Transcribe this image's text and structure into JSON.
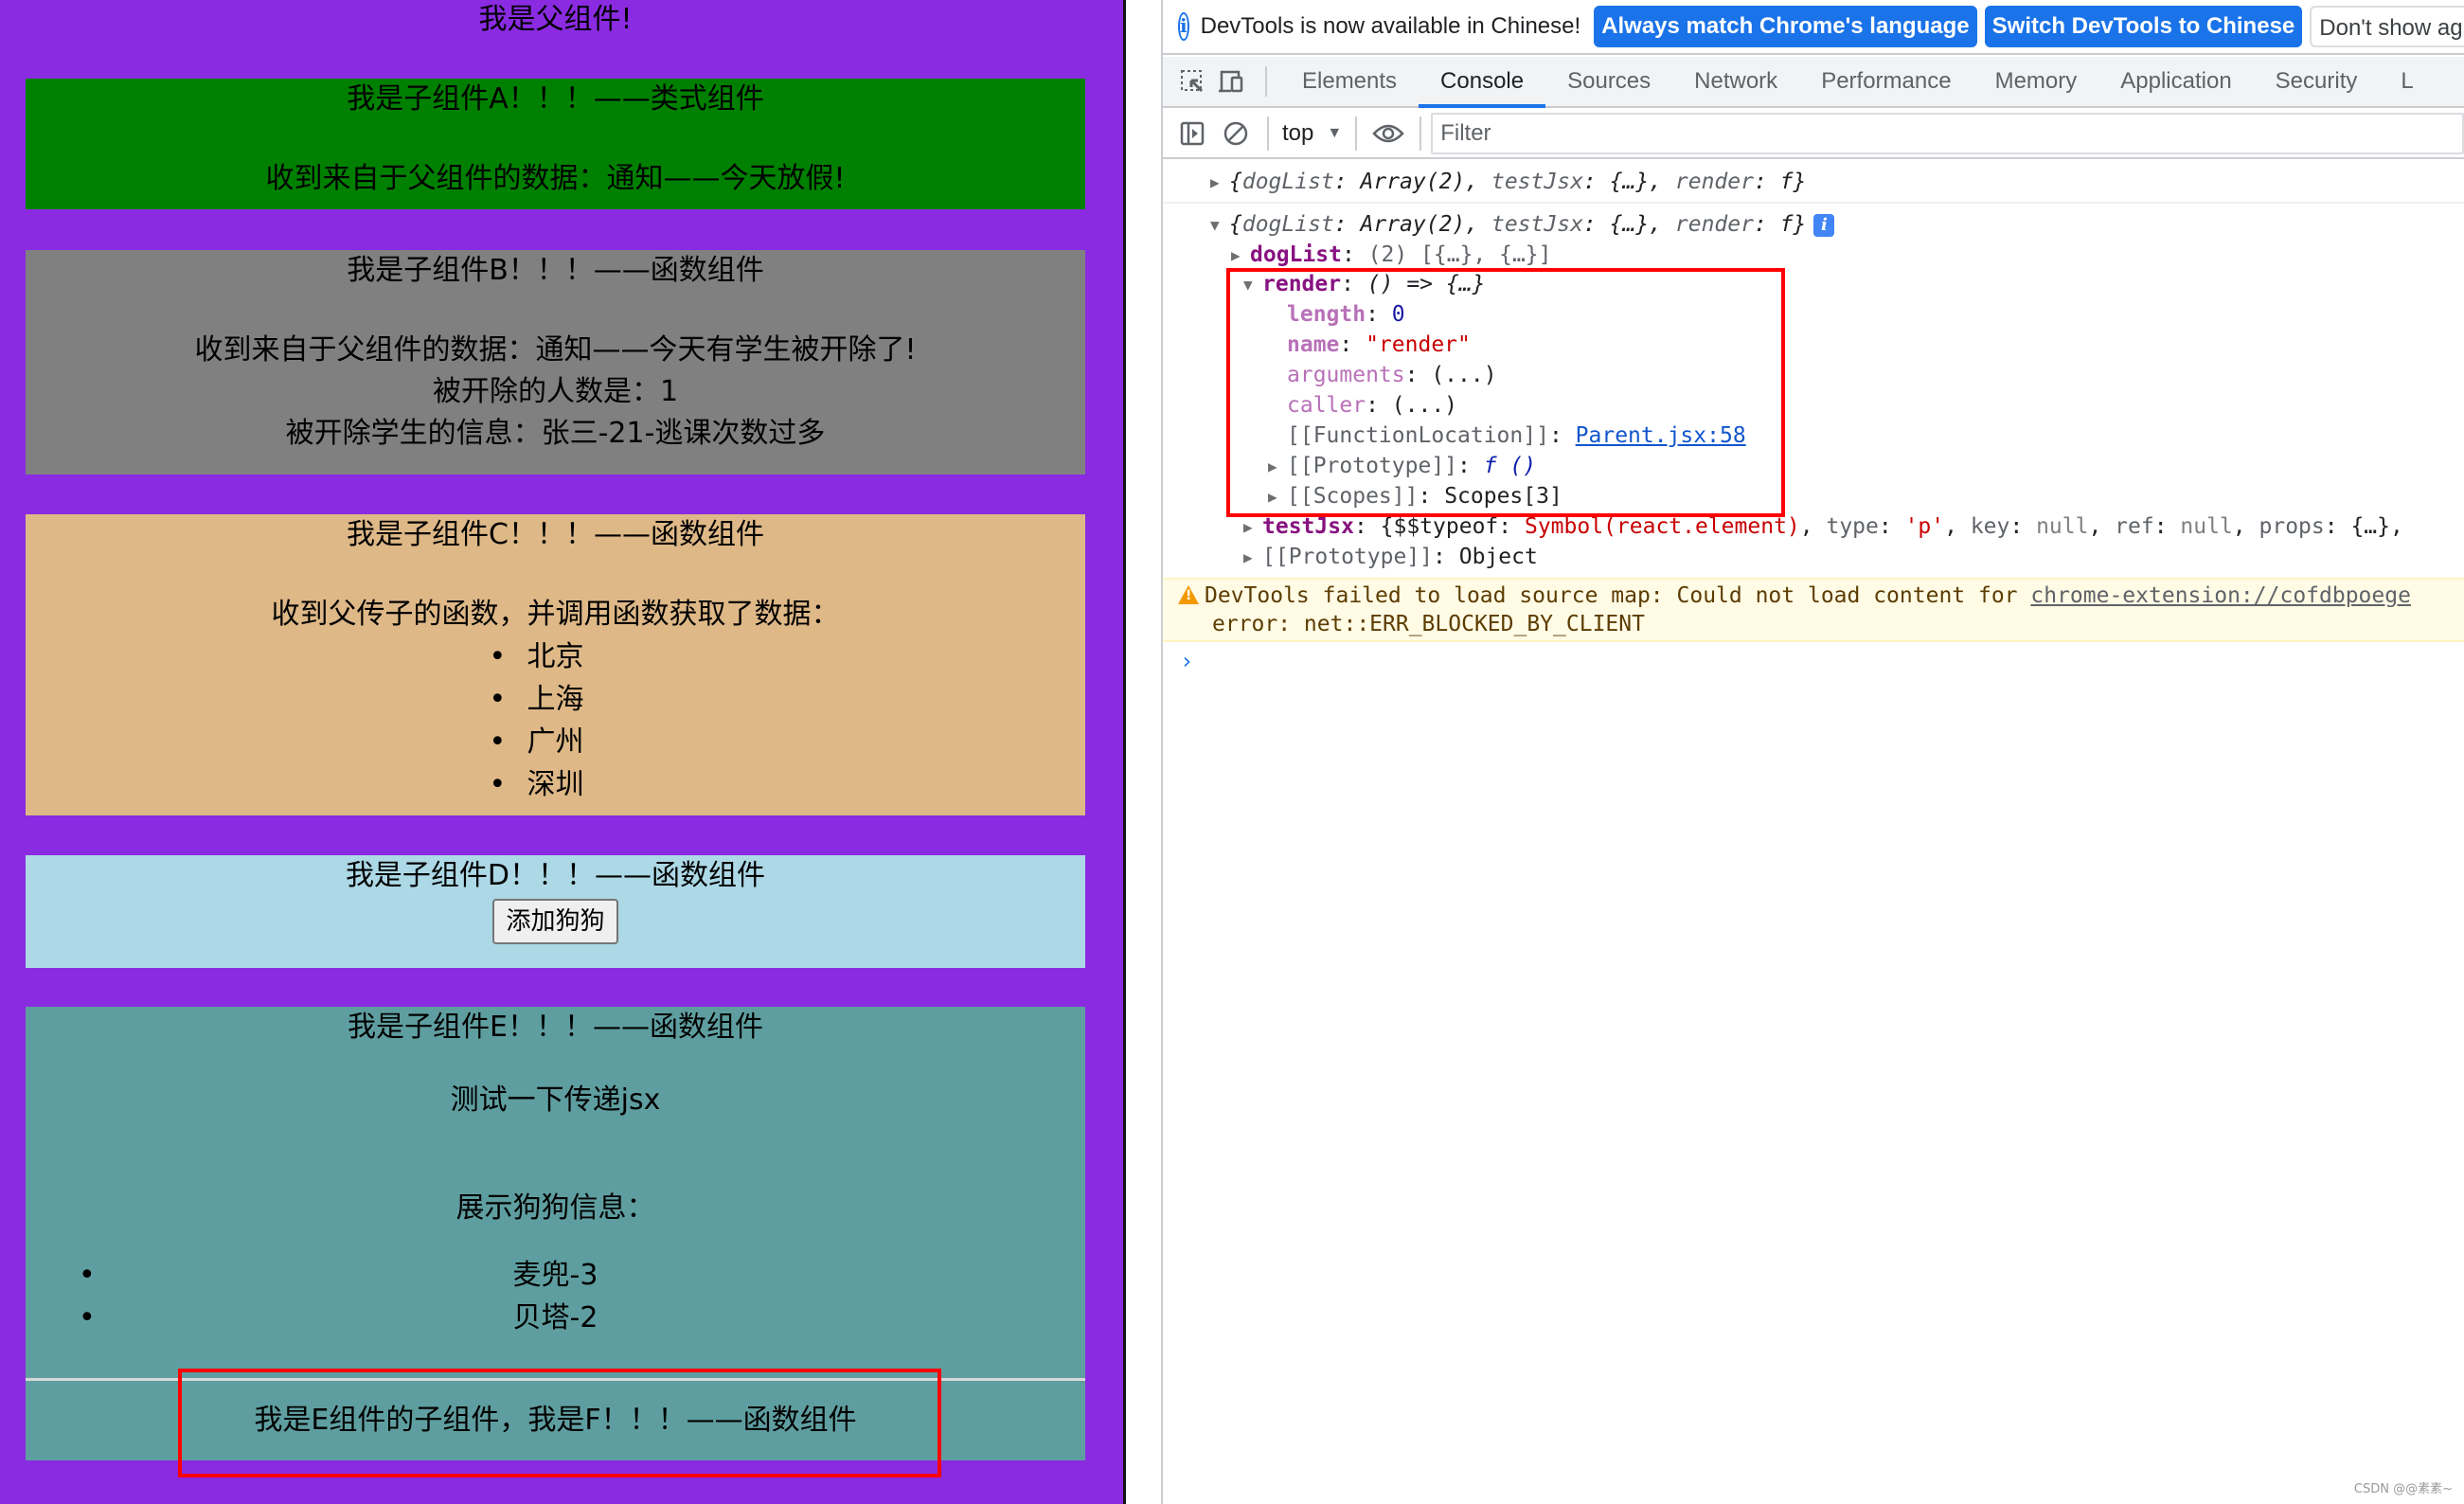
{
  "app": {
    "parent_title": "我是父组件!",
    "background_color": "#8a2be2",
    "child_a": {
      "title": "我是子组件A！！！——类式组件",
      "message": "收到来自于父组件的数据：通知——今天放假!",
      "color": "#008000"
    },
    "child_b": {
      "title": "我是子组件B！！！——函数组件",
      "message": "收到来自于父组件的数据：通知——今天有学生被开除了!",
      "count_line": "被开除的人数是：1",
      "info_line": "被开除学生的信息：张三-21-逃课次数过多",
      "color": "#808080"
    },
    "child_c": {
      "title": "我是子组件C！！！——函数组件",
      "message": "收到父传子的函数，并调用函数获取了数据：",
      "cities": [
        "北京",
        "上海",
        "广州",
        "深圳"
      ],
      "color": "#deb887"
    },
    "child_d": {
      "title": "我是子组件D！！！——函数组件",
      "add_dog_button": "添加狗狗",
      "color": "#add8e6"
    },
    "child_e": {
      "title": "我是子组件E！！！——函数组件",
      "jsx_text": "测试一下传递jsx",
      "dog_title": "展示狗狗信息：",
      "dogs": [
        "麦兜-3",
        "贝塔-2"
      ],
      "color": "#5f9ea0",
      "child_f": {
        "title": "我是E组件的子组件，我是F！！！——函数组件"
      }
    }
  },
  "devtools": {
    "infobar": {
      "message": "DevTools is now available in Chinese!",
      "always_match_button": "Always match Chrome's language",
      "switch_button": "Switch DevTools to Chinese",
      "dont_show_button": "Don't show ag"
    },
    "tabs": [
      "Elements",
      "Console",
      "Sources",
      "Network",
      "Performance",
      "Memory",
      "Application",
      "Security",
      "L"
    ],
    "active_tab": "Console",
    "toolbar": {
      "context": "top",
      "filter_placeholder": "Filter"
    },
    "console": {
      "collapsed_object": {
        "open": "{",
        "k1": "dogList",
        "v1": "Array(2)",
        "k2": "testJsx",
        "v2": "{…}",
        "k3": "render",
        "v3": "f",
        "close": "}"
      },
      "expanded_object": {
        "dogList": {
          "key": "dogList",
          "value": "(2) [{…}, {…}]"
        },
        "render": {
          "key": "render",
          "value": "() => {…}",
          "length": {
            "key": "length",
            "value": "0"
          },
          "name": {
            "key": "name",
            "value": "\"render\""
          },
          "arguments": {
            "key": "arguments",
            "value": "(...)"
          },
          "caller": {
            "key": "caller",
            "value": "(...)"
          },
          "function_location": {
            "key": "[[FunctionLocation]]",
            "value": "Parent.jsx:58"
          },
          "prototype": {
            "key": "[[Prototype]]",
            "value": "f ()"
          },
          "scopes": {
            "key": "[[Scopes]]",
            "value": "Scopes[3]"
          }
        },
        "testJsx": {
          "key": "testJsx",
          "typeof_key": "$$typeof",
          "typeof_value": "Symbol(react.element)",
          "type_key": "type",
          "type_value": "'p'",
          "key_key": "key",
          "key_value": "null",
          "ref_key": "ref",
          "ref_value": "null",
          "props_key": "props",
          "props_value": "{…},"
        },
        "prototype": {
          "key": "[[Prototype]]",
          "value": "Object"
        }
      },
      "warning": {
        "line1": "DevTools failed to load source map: Could not load content for ",
        "link": "chrome-extension://cofdbpoege",
        "line2": "error: net::ERR_BLOCKED_BY_CLIENT"
      },
      "prompt": "›"
    }
  },
  "watermark": "CSDN @@素素~"
}
